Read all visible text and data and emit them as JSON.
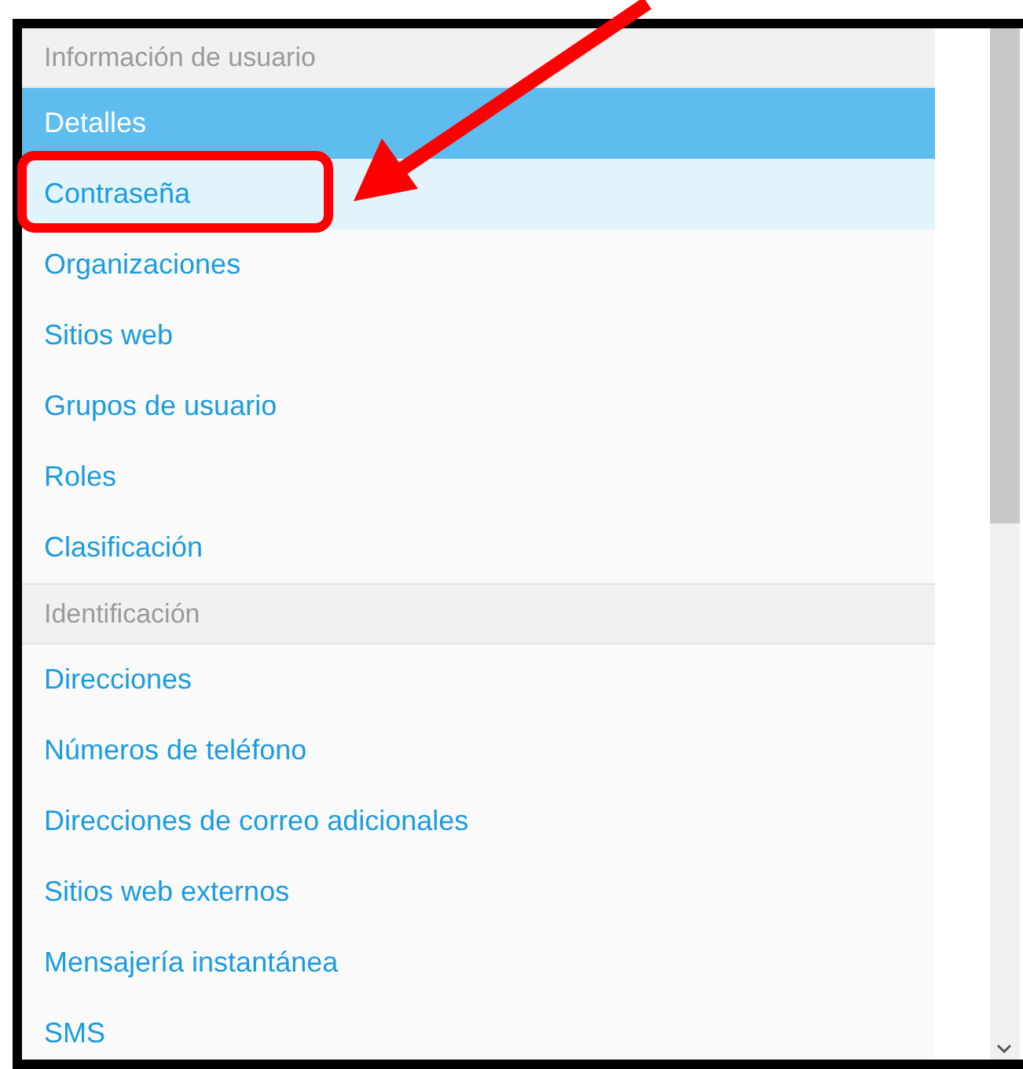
{
  "sections": [
    {
      "title": "Información de usuario",
      "items": [
        {
          "label": "Detalles",
          "selected": true,
          "hovered": false
        },
        {
          "label": "Contraseña",
          "selected": false,
          "hovered": true
        },
        {
          "label": "Organizaciones",
          "selected": false,
          "hovered": false
        },
        {
          "label": "Sitios web",
          "selected": false,
          "hovered": false
        },
        {
          "label": "Grupos de usuario",
          "selected": false,
          "hovered": false
        },
        {
          "label": "Roles",
          "selected": false,
          "hovered": false
        },
        {
          "label": "Clasificación",
          "selected": false,
          "hovered": false
        }
      ]
    },
    {
      "title": "Identificación",
      "items": [
        {
          "label": "Direcciones",
          "selected": false,
          "hovered": false
        },
        {
          "label": "Números de teléfono",
          "selected": false,
          "hovered": false
        },
        {
          "label": "Direcciones de correo adicionales",
          "selected": false,
          "hovered": false
        },
        {
          "label": "Sitios web externos",
          "selected": false,
          "hovered": false
        },
        {
          "label": "Mensajería instantánea",
          "selected": false,
          "hovered": false
        },
        {
          "label": "SMS",
          "selected": false,
          "hovered": false
        }
      ]
    }
  ]
}
